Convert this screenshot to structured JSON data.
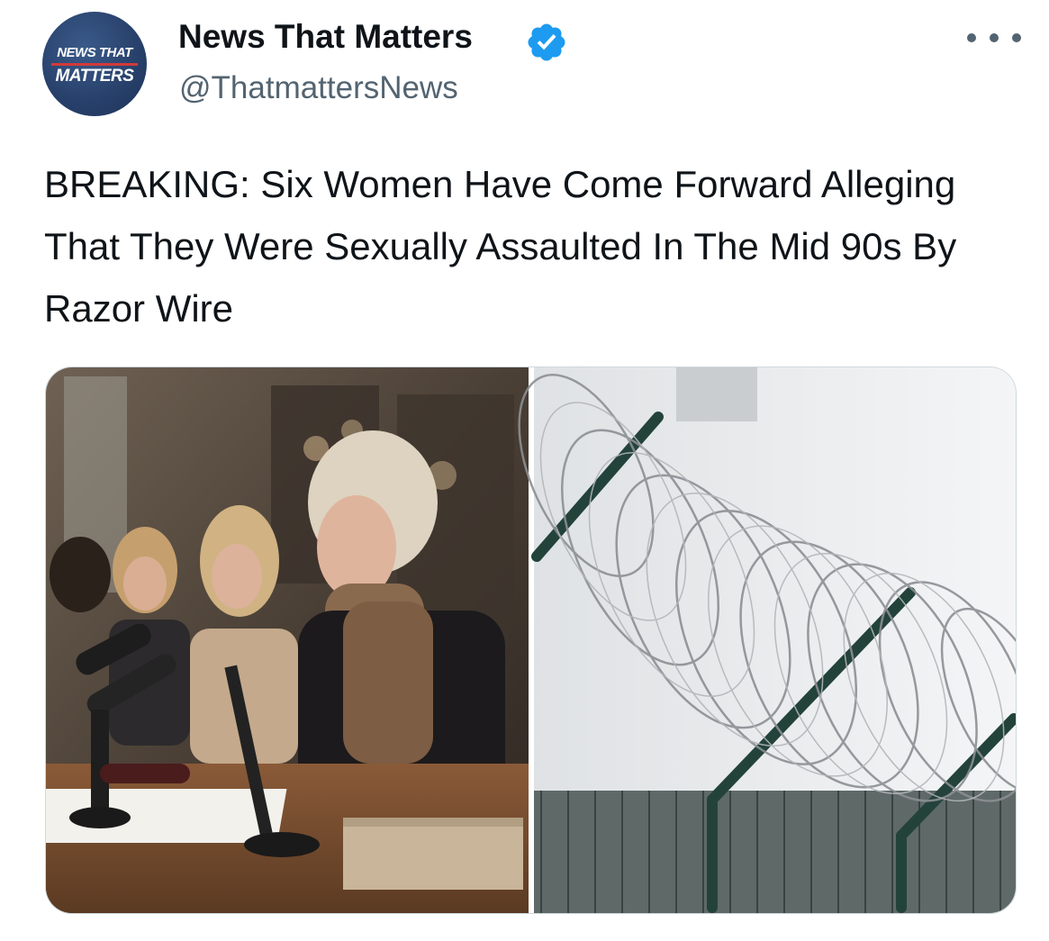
{
  "author": {
    "display_name": "News That Matters",
    "handle": "@ThatmattersNews",
    "verified": true,
    "avatar_text_top": "NEWS THAT",
    "avatar_text_bottom": "MATTERS"
  },
  "tweet": {
    "text": "BREAKING: Six Women Have Come Forward Alleging That They Were Sexually Assaulted In The Mid 90s By Razor Wire"
  },
  "media": [
    {
      "name": "press-conference-photo"
    },
    {
      "name": "razor-wire-photo"
    }
  ],
  "icons": {
    "verified": "verified-badge-icon",
    "more": "more-options-icon"
  },
  "colors": {
    "verified_blue": "#1d9bf0",
    "secondary_text": "#536471",
    "avatar_navy": "#27406a",
    "avatar_red": "#d23a3a"
  }
}
